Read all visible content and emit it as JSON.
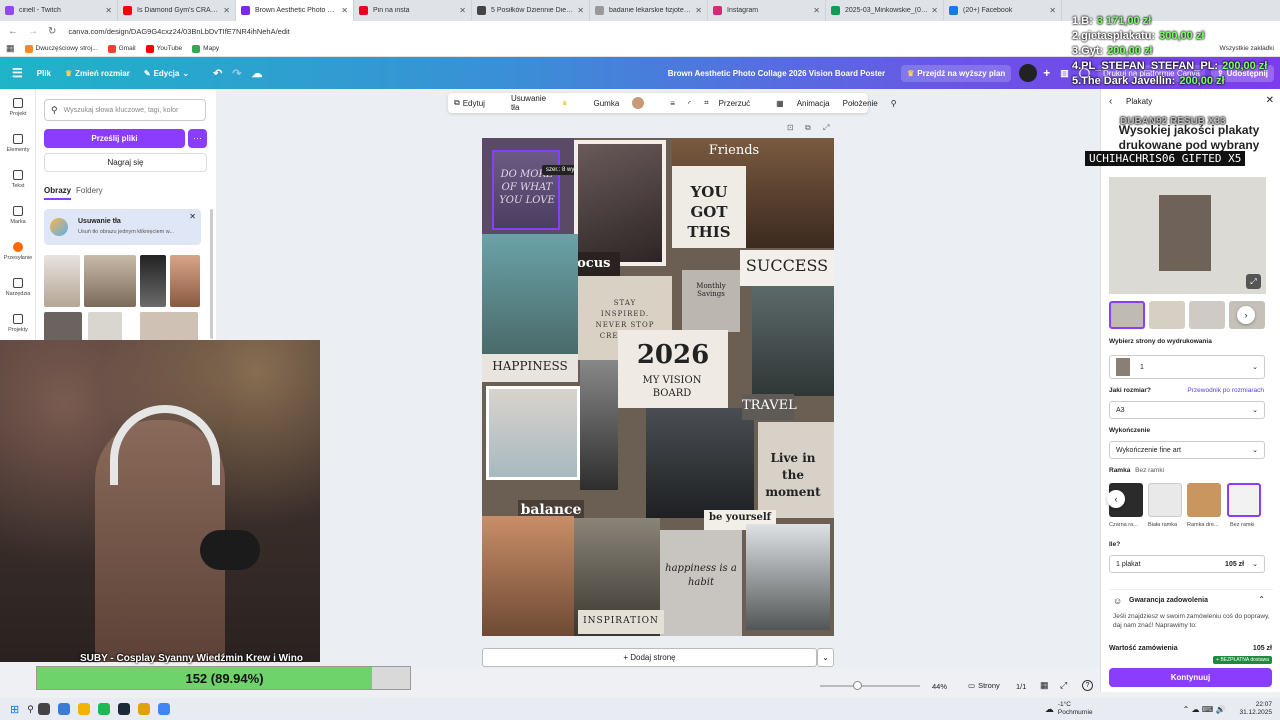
{
  "browser": {
    "tabs": [
      {
        "title": "ciriell - Twitch",
        "color": "#9146ff",
        "active": false
      },
      {
        "title": "Is Diamond Gym's CRAZY Ene...",
        "color": "#ff0000",
        "active": false
      },
      {
        "title": "Brown Aesthetic Photo Collage",
        "color": "#7d2ae8",
        "active": true
      },
      {
        "title": "Pin na insta",
        "color": "#e60023",
        "active": false
      },
      {
        "title": "5 Posiłków Dziennie Dieta Pudeł...",
        "color": "#444444",
        "active": false
      },
      {
        "title": "badanie lekarskie fizjoterapia g...",
        "color": "#999999",
        "active": false
      },
      {
        "title": "Instagram",
        "color": "#d62976",
        "active": false
      },
      {
        "title": "2025-03_Minkowskie_(08)_Pale...",
        "color": "#0f9d58",
        "active": false
      },
      {
        "title": "(20+) Facebook",
        "color": "#1877f2",
        "active": false
      }
    ],
    "url": "canva.com/design/DAG9G4cxz24/03BnLbDvTIfE7NR4ihNehA/edit",
    "bookmarks": [
      "Dwuczęściowy stroj...",
      "Gmail",
      "YouTube",
      "Mapy"
    ],
    "all_bookmarks": "Wszystkie zakładki"
  },
  "canva_header": {
    "file": "Plik",
    "resize": "Zmień rozmiar",
    "edit": "Edycja",
    "doc_title": "Brown Aesthetic Photo Collage 2026 Vision Board Poster",
    "upgrade": "Przejdź na wyższy plan",
    "print": "Drukuj na platformie Canva",
    "share": "Udostępnij"
  },
  "rail": [
    {
      "label": "Projekt",
      "icon": "layout-icon"
    },
    {
      "label": "Elementy",
      "icon": "shapes-icon"
    },
    {
      "label": "Tekst",
      "icon": "text-icon"
    },
    {
      "label": "Marka",
      "icon": "brand-icon"
    },
    {
      "label": "Przesyłanie",
      "icon": "upload-icon"
    },
    {
      "label": "Narzędzia",
      "icon": "tools-icon"
    },
    {
      "label": "Projekty",
      "icon": "folder-icon"
    }
  ],
  "upload_panel": {
    "search_placeholder": "Wyszukaj słowa kluczowe, tagi, kolor",
    "upload_button": "Prześlij pliki",
    "record_button": "Nagraj się",
    "tab_images": "Obrazy",
    "tab_folders": "Foldery",
    "promo_title": "Usuwanie tła",
    "promo_text": "Usuń tło obrazu jednym kliknięciem w..."
  },
  "context_toolbar": {
    "edit": "Edytuj",
    "bg_remove": "Usuwanie tła",
    "eraser": "Gumka",
    "crop": "Przerzuć",
    "animate": "Animacja",
    "position": "Położenie",
    "fill_color": "#c89a7a"
  },
  "poster": {
    "tooltip": "szer.: 8 wys.: 9,7",
    "labels": {
      "friends": "Friends",
      "you_got_this": "YOU GOT THIS",
      "focus": "focus",
      "success": "SUCCESS",
      "monthly": "Monthly Savings",
      "stay": "STAY INSPIRED. NEVER STOP CREATING.",
      "happiness": "HAPPINESS",
      "year": "2026",
      "my_vision": "MY VISION BOARD",
      "travel": "TRAVEL",
      "live": "Live in the moment",
      "balance": "balance",
      "be_yourself": "be yourself",
      "habit": "happiness is a habit",
      "inspiration": "INSPIRATION",
      "quote": "DO MORE OF WHAT YOU LOVE"
    },
    "add_page": "+ Dodaj stronę"
  },
  "status_bar": {
    "zoom": "44%",
    "pages_label": "Strony",
    "page_count": "1/1"
  },
  "print_panel": {
    "breadcrumb": "Plakaty",
    "heading": "Wysokiej jakości plakaty drukowane pod wybrany",
    "pages_label": "Wybierz strony do wydrukowania",
    "pages_value": "1",
    "size_label": "Jaki rozmiar?",
    "size_guide": "Przewodnik po rozmiarach",
    "size_value": "A3",
    "finish_label": "Wykończenie",
    "finish_value": "Wykończenie fine art",
    "frame_label": "Ramka",
    "frame_value": "Bez ramki",
    "frames": [
      "Czarna ra...",
      "Biała ramka",
      "Ramka dre...",
      "Bez ramki"
    ],
    "qty_label": "Ile?",
    "qty_value": "1 plakat",
    "qty_price": "105 zł",
    "guarantee_title": "Gwarancja zadowolenia",
    "guarantee_text": "Jeśli znajdziesz w swoim zamówieniu coś do poprawy, daj nam znać! Naprawimy to:",
    "total_label": "Wartość zamówienia",
    "total_value": "105 zł",
    "free_delivery": "+ BEZPŁATNA dostawa",
    "continue": "Kontynuuj"
  },
  "stream_overlay": {
    "leaderboard": [
      {
        "rank": "1.B:",
        "value": "3 171,00 zł"
      },
      {
        "rank": "2.gietasplakatu:",
        "value": "300,00 zł"
      },
      {
        "rank": "3.Gyt:",
        "value": "200,00 zł"
      },
      {
        "rank": "4.PL_STEFAN_STEFAN_PL:",
        "value": "200,00 zł"
      },
      {
        "rank": "5.The Dark Javellin:",
        "value": "200,00 zł"
      }
    ],
    "sub_line": "DUBAN92  RESUB X33",
    "gift_line": "UCHIHACHRIS06  GIFTED X5",
    "sub_title": "SUBY - Cosplay Syanny Wiedźmin Krew i Wino",
    "progress_text": "152 (89.94%)",
    "progress": 0.8994
  },
  "taskbar": {
    "weather": "-1°C",
    "weather_sub": "Pochmurnie",
    "time": "22:07",
    "date": "31.12.2025"
  }
}
